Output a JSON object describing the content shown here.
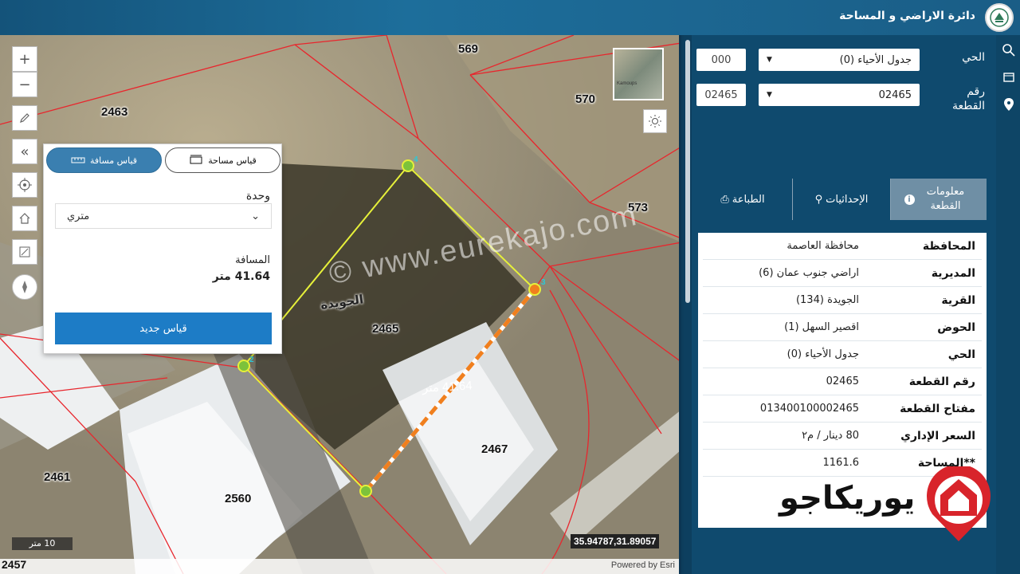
{
  "header": {
    "title": "دائرة الاراضي و المساحة"
  },
  "map": {
    "parcels": {
      "p569": "569",
      "p570": "570",
      "p2463": "2463",
      "p573": "573",
      "p2465": "2465",
      "p2467": "2467",
      "p2461": "2461",
      "p2560": "2560",
      "p2457": "2457"
    },
    "village_label": "الجويدة",
    "watermark": "© www.eurekajo.com",
    "measure_line_label": "41.64 متر",
    "vertex_labels": [
      "4",
      "3",
      "2"
    ],
    "scale": "10 متر",
    "coordinates": "35.94787,31.89057",
    "powered_by": "Powered by Esri",
    "minimap_text": "Kamoups"
  },
  "measure_panel": {
    "tab_area": "قياس مساحة",
    "tab_distance": "قياس مسافة",
    "unit_label": "وحدة",
    "unit_value": "متري",
    "distance_label": "المسافة",
    "distance_value": "41.64 متر",
    "new_button": "قياس جديد"
  },
  "sidebar": {
    "district_label": "الحي",
    "district_code": "000",
    "district_select": "جدول الأحياء (0)",
    "plot_label": "رقم القطعة",
    "plot_code": "02465",
    "plot_select": "02465",
    "tabs": {
      "info": "معلومات القطعة",
      "coords": "الإحداثيات",
      "print": "الطباعة"
    },
    "rows": [
      {
        "key": "المحافظة",
        "value": "محافظة العاصمة"
      },
      {
        "key": "المديرية",
        "value": "اراضي جنوب عمان (6)"
      },
      {
        "key": "القرية",
        "value": "الجويدة (134)"
      },
      {
        "key": "الحوض",
        "value": "اقصير السهل (1)"
      },
      {
        "key": "الحي",
        "value": "جدول الأحياء (0)"
      },
      {
        "key": "رقم القطعة",
        "value": "02465"
      },
      {
        "key": "مفتاح القطعة",
        "value": "013400100002465"
      },
      {
        "key": "السعر الإداري",
        "value": "80 دينار / م٢"
      },
      {
        "key": "**المساحة",
        "value": "1161.6"
      }
    ]
  },
  "brand": {
    "name": "يوريكاجو"
  },
  "colors": {
    "header": "#1a5d86",
    "sidebar": "#0f4a6e",
    "accent_button": "#1d7cc6",
    "parcel_line": "#e8262d",
    "measure_line": "#f07f1e",
    "polygon_line": "#e6f03a"
  }
}
